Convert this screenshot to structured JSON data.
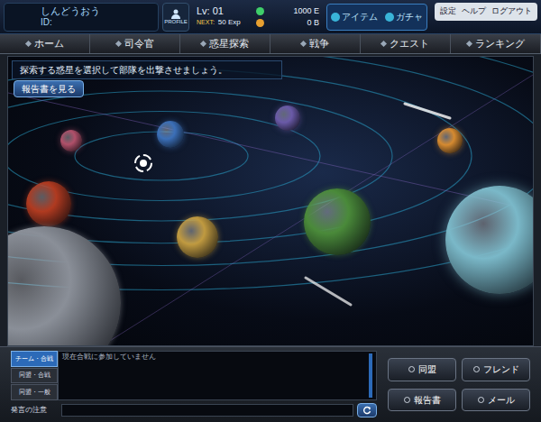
{
  "header": {
    "player_name": "しんどうおう",
    "id_label": "ID:",
    "profile_label": "PROFILE",
    "level": "Lv: 01",
    "next_label": "NEXT:",
    "next_exp": "50 Exp",
    "currencies": [
      {
        "amount": "1000 E",
        "color": "#3fcf6a"
      },
      {
        "amount": "0 B",
        "color": "#e8a030"
      }
    ]
  },
  "shop_buttons": [
    {
      "label": "アイテム"
    },
    {
      "label": "ガチャ"
    }
  ],
  "system_links": [
    "設定",
    "ヘルプ",
    "ログアウト"
  ],
  "nav": [
    {
      "label": "ホーム",
      "selected": false
    },
    {
      "label": "司令官",
      "selected": false
    },
    {
      "label": "惑星探索",
      "selected": false
    },
    {
      "label": "戦争",
      "selected": false
    },
    {
      "label": "クエスト",
      "selected": false
    },
    {
      "label": "ランキング",
      "selected": false
    }
  ],
  "map": {
    "hint": "探索する惑星を選択して部隊を出撃させましょう。",
    "report_button": "報告書を見る",
    "planets": [
      {
        "color": "#b0506a"
      },
      {
        "color": "#3b6fb8"
      },
      {
        "color": "#6a5aa8"
      },
      {
        "color": "#d58a30"
      },
      {
        "color": "#b03a20"
      },
      {
        "color": "#c09a40"
      },
      {
        "color": "#4a8a3a"
      },
      {
        "color": "#7ab8c8"
      },
      {
        "color": "#8a8f98"
      }
    ]
  },
  "chat": {
    "tabs": [
      {
        "label": "チーム・合戦",
        "selected": true
      },
      {
        "label": "同盟・合戦",
        "selected": false
      },
      {
        "label": "同盟・一般",
        "selected": false
      }
    ],
    "message": "現在合戦に参加していません",
    "notice": "発言の注意"
  },
  "actions": [
    "同盟",
    "フレンド",
    "報告書",
    "メール"
  ]
}
